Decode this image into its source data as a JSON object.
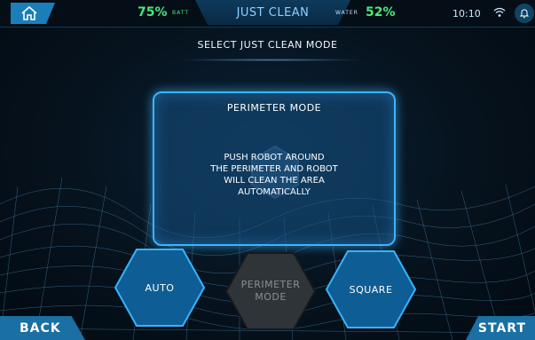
{
  "topbar": {
    "battery_value": "75%",
    "battery_label": "BATT",
    "title": "JUST CLEAN",
    "water_label": "WATER",
    "water_value": "52%",
    "time": "10:10",
    "icons": [
      "home-icon",
      "wifi-icon",
      "bell-icon"
    ]
  },
  "subtitle": "SELECT JUST CLEAN MODE",
  "panel": {
    "title": "PERIMETER MODE",
    "description": "PUSH ROBOT AROUND\nTHE PERIMETER AND ROBOT\nWILL CLEAN THE AREA\nAUTOMATICALLY"
  },
  "modes": {
    "auto": "AUTO",
    "perimeter": "PERIMETER\nMODE",
    "square": "SQUARE",
    "selected": "perimeter"
  },
  "nav": {
    "back": "BACK",
    "start": "START"
  },
  "colors": {
    "accent": "#3db3ff",
    "status_green": "#49e87a",
    "button_blue": "#1a6fa3",
    "background": "#06121d"
  }
}
